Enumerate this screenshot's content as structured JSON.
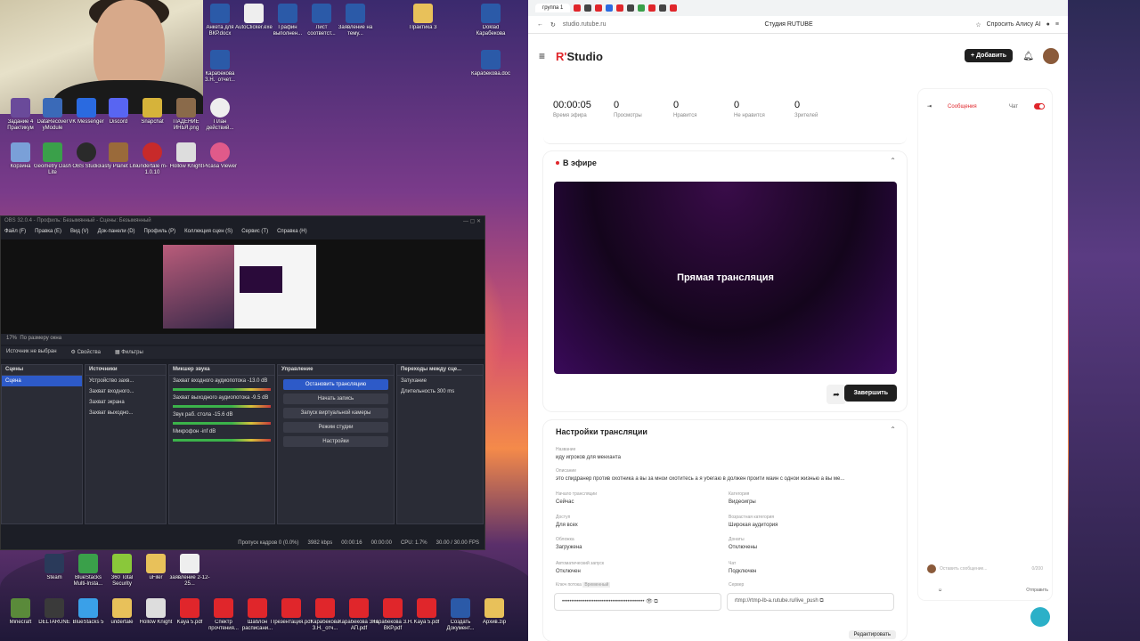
{
  "desktop": {
    "icons_top": [
      {
        "label": "Задание 4 Практикум",
        "color": "#6a4a9a"
      },
      {
        "label": "DataRecover yModule",
        "color": "#3a6ab8"
      },
      {
        "label": "VK Messenger",
        "color": "#2a6ae0"
      },
      {
        "label": "Discord",
        "color": "#5865f2"
      },
      {
        "label": "Snapchat",
        "color": "#d6b33a"
      },
      {
        "label": "ПАДЕНИЕ ИНЬЯ.png",
        "color": "#8a6a4a"
      },
      {
        "label": "Корзина",
        "color": "#7aa0d8"
      },
      {
        "label": "Geometry Dash Lite",
        "color": "#3aa04a"
      },
      {
        "label": "OBS Studio",
        "color": "#2a2a2a"
      },
      {
        "label": "Tasty Planet Lite",
        "color": "#9a6a3a"
      },
      {
        "label": "undertale m-1.0.10",
        "color": "#c82a2a"
      },
      {
        "label": "Hollow Knight",
        "color": "#ddd"
      },
      {
        "label": "Picasa Viewer",
        "color": "#e05a8a"
      }
    ],
    "files": [
      {
        "label": "Анкета для ВКР.docx"
      },
      {
        "label": "AutoClicker.exe"
      },
      {
        "label": "Графин выполнен..."
      },
      {
        "label": "Лист соответст..."
      },
      {
        "label": "Заявление на тему..."
      },
      {
        "label": "Практика 3"
      },
      {
        "label": "Doklad Карабекова"
      },
      {
        "label": "Карабекова З.Н._отчет..."
      },
      {
        "label": "План действий..."
      },
      {
        "label": "Карабекова.doc"
      }
    ],
    "taskbar_icons": [
      {
        "label": "Steam"
      },
      {
        "label": "BlueStacks Multi-Insta..."
      },
      {
        "label": "360 Total Security"
      },
      {
        "label": "uFiler"
      },
      {
        "label": "заявление 2-12-25..."
      },
      {
        "label": "Minecraft"
      },
      {
        "label": "DELTARUNE"
      },
      {
        "label": "BlueStacks 5"
      },
      {
        "label": "undertale"
      },
      {
        "label": "Hollow Knight"
      },
      {
        "label": "Kaya 5.pdf"
      },
      {
        "label": "Спектр прочтения..."
      },
      {
        "label": "Шаблон расписани..."
      },
      {
        "label": "Презентация.pdf"
      },
      {
        "label": "Карабекова З.Н._отч..."
      },
      {
        "label": "Карабекова З.Н. АП.pdf"
      },
      {
        "label": "Карабекова З.Н. ВКР.pdf"
      },
      {
        "label": "Kaya 5.pdf"
      },
      {
        "label": "Создать Документ..."
      },
      {
        "label": "Архив.zip"
      }
    ]
  },
  "obs": {
    "title": "OBS 32.0.4 - Профиль: Безымянный - Сцены: Безымянный",
    "menu": [
      "Файл (F)",
      "Правка (E)",
      "Вид (V)",
      "Док-панели (D)",
      "Профиль (P)",
      "Коллекция сцен (S)",
      "Сервис (T)",
      "Справка (H)"
    ],
    "zoom": "17%",
    "zoom_mode": "По размеру окна",
    "source_status": "Источник не выбран",
    "properties_label": "Свойства",
    "filters_label": "Фильтры",
    "scenes_header": "Сцены",
    "scene_item": "Сцена",
    "sources_header": "Источники",
    "sources": [
      "Устройство захв...",
      "Захват входного...",
      "Захват экрана",
      "Захват выходно..."
    ],
    "mixer_header": "Микшер звука",
    "mixer": [
      {
        "name": "Захват входного аудиопотока",
        "db": "-13.0 dB"
      },
      {
        "name": "Захват выходного аудиопотока",
        "db": "-9.5 dB"
      },
      {
        "name": "Звук раб. стола",
        "db": "-15.6 dB"
      },
      {
        "name": "Микрофон",
        "db": "-inf dB"
      }
    ],
    "controls_header": "Управление",
    "controls": [
      "Остановить трансляцию",
      "Начать запись",
      "Запуск виртуальной камеры",
      "Режим студии",
      "Настройки"
    ],
    "transitions_header": "Переходы между сце...",
    "transition": "Затухание",
    "duration_label": "Длительность",
    "duration": "300 ms",
    "status": [
      "Пропуск кадров 0 (0.0%)",
      "3982 kbps",
      "00:00:16",
      "00:00:00",
      "CPU: 1.7%",
      "30.00 / 30.00 FPS"
    ]
  },
  "browser": {
    "tab_title": "группа 1",
    "url": "studio.rutube.ru",
    "page_title": "Студия RUTUBE",
    "alice_label": "Спросить Алису AI"
  },
  "studio": {
    "logo_r": "R'",
    "logo_text": "Studio",
    "add_label": "Добавить",
    "stats": [
      {
        "value": "00:00:05",
        "label": "Время эфира"
      },
      {
        "value": "0",
        "label": "Просмотры"
      },
      {
        "value": "0",
        "label": "Нравится"
      },
      {
        "value": "0",
        "label": "Не нравится"
      },
      {
        "value": "0",
        "label": "Зрителей"
      }
    ],
    "live_title": "В эфире",
    "player_text": "Прямая трансляция",
    "finish_label": "Завершить",
    "settings_title": "Настройки трансляции",
    "fields": {
      "name_label": "Название",
      "name": "иду игроков для менханта",
      "desc_label": "Описание",
      "desc": "это спидранер против охотника а вы за мной охотитесь а я убегаю в должен пройти майн с одной жизнью а вы ме...",
      "start_label": "Начало трансляции",
      "start": "Сейчас",
      "category_label": "Категория",
      "category": "Видеоигры",
      "access_label": "Доступ",
      "access": "Для всех",
      "age_label": "Возрастная категория",
      "age": "Широкая аудитория",
      "cover_label": "Обложка",
      "cover": "Загружена",
      "donate_label": "Донаты",
      "donate": "Отключены",
      "autostart_label": "Автоматический запуск",
      "autostart": "Отключен",
      "chat_label": "Чат",
      "chat": "Подключен",
      "key_label": "Ключ потока",
      "key_badge": "Временный",
      "key_value": "••••••••••••••••••••••••••••••••••••••••••••",
      "server_label": "Сервер",
      "server": "rtmp://rtmp-lb-a.rutube.ru/live_push",
      "edit_label": "Редактировать"
    },
    "chat": {
      "tab_messages": "Сообщения",
      "tab_chat": "Чат",
      "input_placeholder": "Оставить сообщение...",
      "counter": "0/200",
      "send_label": "Отправить"
    }
  },
  "colors": {
    "accent": "#e0262b",
    "obs_primary": "#2d5ac8"
  }
}
